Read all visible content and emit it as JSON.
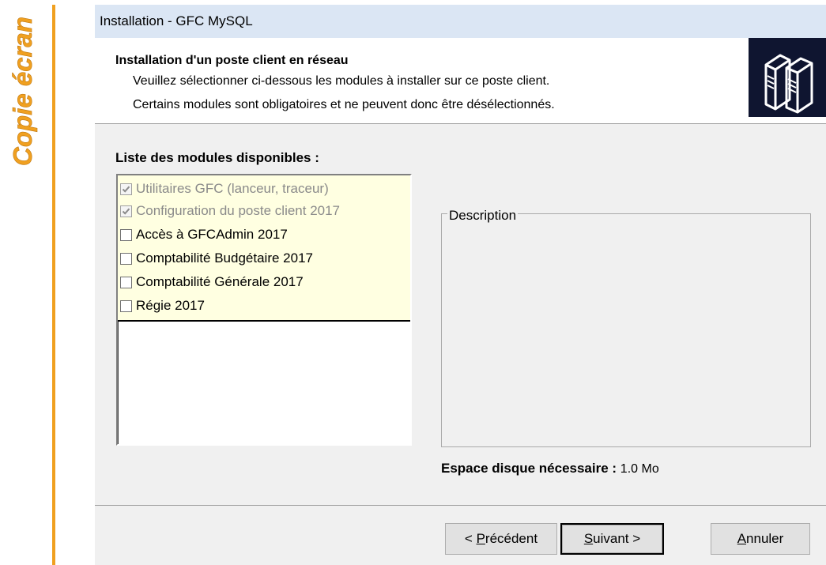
{
  "side": {
    "text": "Copie écran",
    "accent": "#f0a020"
  },
  "window": {
    "title": "Installation - GFC MySQL"
  },
  "header": {
    "title": "Installation d'un poste client en réseau",
    "line1": "Veuillez sélectionner ci-dessous les modules à installer sur ce poste client.",
    "line2": "Certains modules sont obligatoires et ne peuvent donc être désélectionnés.",
    "logo_icon": "servers-icon"
  },
  "modules": {
    "label": "Liste des modules disponibles :",
    "items": [
      {
        "label": "Utilitaires GFC (lanceur, traceur)",
        "checked": true,
        "disabled": true
      },
      {
        "label": "Configuration du poste client 2017",
        "checked": true,
        "disabled": true
      },
      {
        "label": "Accès à GFCAdmin 2017",
        "checked": false,
        "disabled": false
      },
      {
        "label": "Comptabilité Budgétaire 2017",
        "checked": false,
        "disabled": false
      },
      {
        "label": "Comptabilité Générale 2017",
        "checked": false,
        "disabled": false
      },
      {
        "label": "Régie 2017",
        "checked": false,
        "disabled": false
      }
    ]
  },
  "description": {
    "legend": "Description"
  },
  "disk": {
    "label": "Espace disque nécessaire :",
    "value": "1.0 Mo"
  },
  "buttons": {
    "back": {
      "accel": "P",
      "rest": "récédent",
      "prefix": "< "
    },
    "next": {
      "accel": "S",
      "rest": "uivant",
      "suffix": " >"
    },
    "cancel": {
      "accel": "A",
      "rest": "nnuler"
    }
  }
}
